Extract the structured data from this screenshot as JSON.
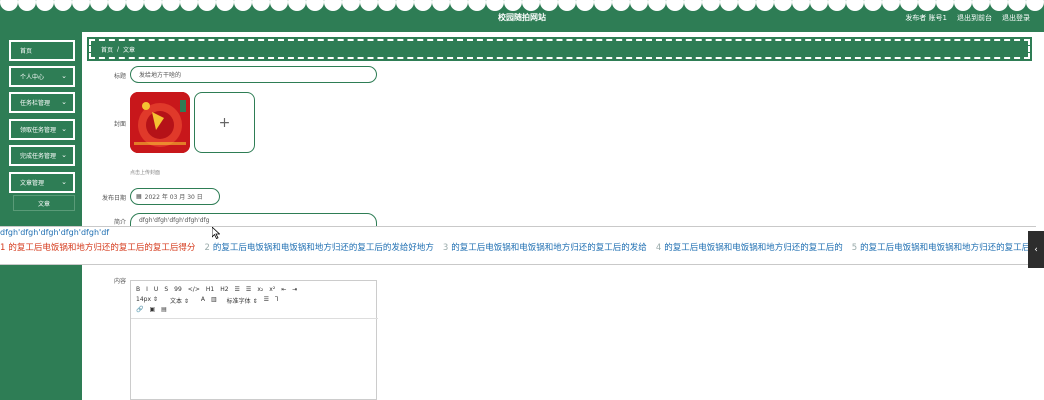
{
  "header": {
    "title": "校园随拍网站",
    "publisher_text": "发布者 账号1",
    "back_to_front": "退出到前台",
    "logout": "退出登录"
  },
  "sidebar": {
    "items": [
      {
        "label": "首页"
      },
      {
        "label": "个人中心",
        "icon": "chevron-down-icon"
      },
      {
        "label": "任务栏管理",
        "icon": "chevron-down-icon"
      },
      {
        "label": "领取任务管理",
        "icon": "chevron-down-icon"
      },
      {
        "label": "完成任务管理",
        "icon": "chevron-down-icon"
      },
      {
        "label": "文章管理",
        "icon": "chevron-down-icon"
      }
    ],
    "sub_item": "文章"
  },
  "breadcrumb": {
    "home": "首页",
    "sep": "/",
    "current": "文章"
  },
  "form": {
    "title_label": "标题",
    "title_value": "发给地方干啥的",
    "cover_label": "封面",
    "upload_plus": "+",
    "upload_hint": "点击上传封面",
    "date_label": "发布日期",
    "date_value": "2022 年 03 月 30 日",
    "intro_label": "简介",
    "intro_value": "dfgh'dfgh'dfgh'dfgh'dfg",
    "content_label": "内容"
  },
  "ime": {
    "typed": "dfgh'dfgh'dfgh'dfgh'dfgh'df",
    "candidates": [
      {
        "num": "1",
        "text": "的复工后电饭锅和地方归还的复工后的复工后得分",
        "selected": true
      },
      {
        "num": "2",
        "text": "的复工后电饭锅和电饭锅和地方归还的复工后的发给好地方",
        "selected": false
      },
      {
        "num": "3",
        "text": "的复工后电饭锅和电饭锅和地方归还的复工后的发给",
        "selected": false
      },
      {
        "num": "4",
        "text": "的复工后电饭锅和电饭锅和地方归还的复工后的",
        "selected": false
      },
      {
        "num": "5",
        "text": "的复工后电饭锅和电饭锅和地方归还的复工后的",
        "selected": false
      }
    ],
    "handle": "‹"
  },
  "editor_toolbar": {
    "row1": [
      "B",
      "I",
      "U",
      "S",
      "99",
      "</>",
      "H1",
      "H2",
      "☰",
      "☰",
      "x₂",
      "x²",
      "⇤",
      "⇥"
    ],
    "font_size": "14px",
    "paragraph": "文本",
    "color_a": "A",
    "font_family": "标准字体",
    "row3": [
      "🔗",
      "▣",
      "▤"
    ]
  },
  "colors": {
    "brand": "#2e7d55",
    "ime_text": "#1f6fb2",
    "ime_selected": "#d53a1c"
  }
}
